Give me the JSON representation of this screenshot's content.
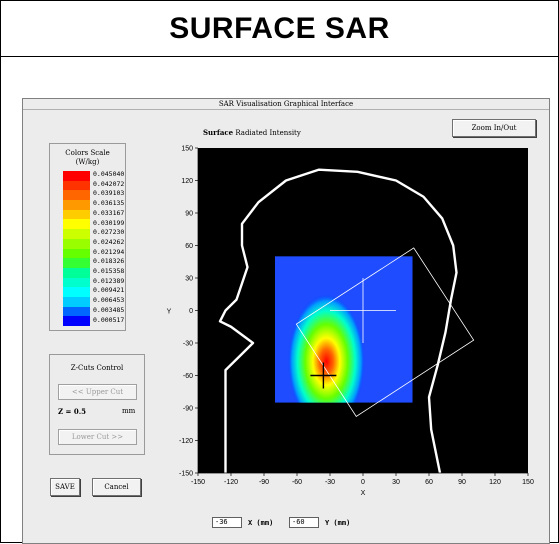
{
  "banner": {
    "title": "SURFACE SAR"
  },
  "window": {
    "title": "SAR Visualisation Graphical Interface"
  },
  "buttons": {
    "zoom": "Zoom In/Out",
    "save": "SAVE",
    "cancel": "Cancel",
    "upper_cut": "<< Upper Cut",
    "lower_cut": "Lower Cut >>"
  },
  "plot": {
    "title_bold": "Surface",
    "title_rest": " Radiated Intensity"
  },
  "color_scale": {
    "title_line1": "Colors Scale",
    "title_line2": "(W/kg)",
    "values": [
      "0.045040",
      "0.042072",
      "0.039103",
      "0.036135",
      "0.033167",
      "0.030199",
      "0.027230",
      "0.024262",
      "0.021294",
      "0.018326",
      "0.015358",
      "0.012389",
      "0.009421",
      "0.006453",
      "0.003485",
      "0.000517"
    ],
    "colors": [
      "#ff0000",
      "#ff3300",
      "#ff6600",
      "#ff9900",
      "#ffcc00",
      "#ffff00",
      "#ccff00",
      "#99ff00",
      "#66ff00",
      "#33ff33",
      "#00ff99",
      "#00ffcc",
      "#00ffff",
      "#00ccff",
      "#0066ff",
      "#0000ff"
    ]
  },
  "zcuts": {
    "label": "Z-Cuts Control",
    "z_label": "Z = 0.5",
    "z_unit": "mm"
  },
  "coords": {
    "x_value": "-36",
    "x_label": "X (mm)",
    "y_value": "-60",
    "y_label": "Y (mm)"
  },
  "chart_data": {
    "type": "heatmap",
    "xlabel": "X",
    "ylabel": "Y",
    "xlim": [
      -150,
      150
    ],
    "ylim": [
      -150,
      150
    ],
    "xticks": [
      -150,
      -120,
      -90,
      -60,
      -30,
      0,
      30,
      60,
      90,
      120,
      150
    ],
    "yticks": [
      150,
      120,
      90,
      60,
      30,
      0,
      -30,
      -60,
      -90,
      -120,
      -150
    ],
    "measurement_area": {
      "x": [
        -80,
        45
      ],
      "y": [
        -85,
        50
      ]
    },
    "hotspot": {
      "x": -36,
      "y": -60
    },
    "crosshair_center": {
      "x": 0,
      "y": 0
    },
    "head_outline": [
      [
        -125,
        -55
      ],
      [
        -125,
        -150
      ],
      [
        -125,
        -55
      ],
      [
        -110,
        -40
      ],
      [
        -100,
        -30
      ],
      [
        -120,
        -15
      ],
      [
        -130,
        -10
      ],
      [
        -125,
        0
      ],
      [
        -115,
        10
      ],
      [
        -105,
        40
      ],
      [
        -110,
        60
      ],
      [
        -110,
        80
      ],
      [
        -95,
        100
      ],
      [
        -70,
        120
      ],
      [
        -40,
        130
      ],
      [
        -5,
        128
      ],
      [
        30,
        120
      ],
      [
        55,
        105
      ],
      [
        72,
        85
      ],
      [
        82,
        60
      ],
      [
        85,
        35
      ],
      [
        80,
        10
      ],
      [
        75,
        -20
      ],
      [
        68,
        -50
      ],
      [
        60,
        -80
      ],
      [
        62,
        -110
      ],
      [
        70,
        -150
      ]
    ]
  }
}
